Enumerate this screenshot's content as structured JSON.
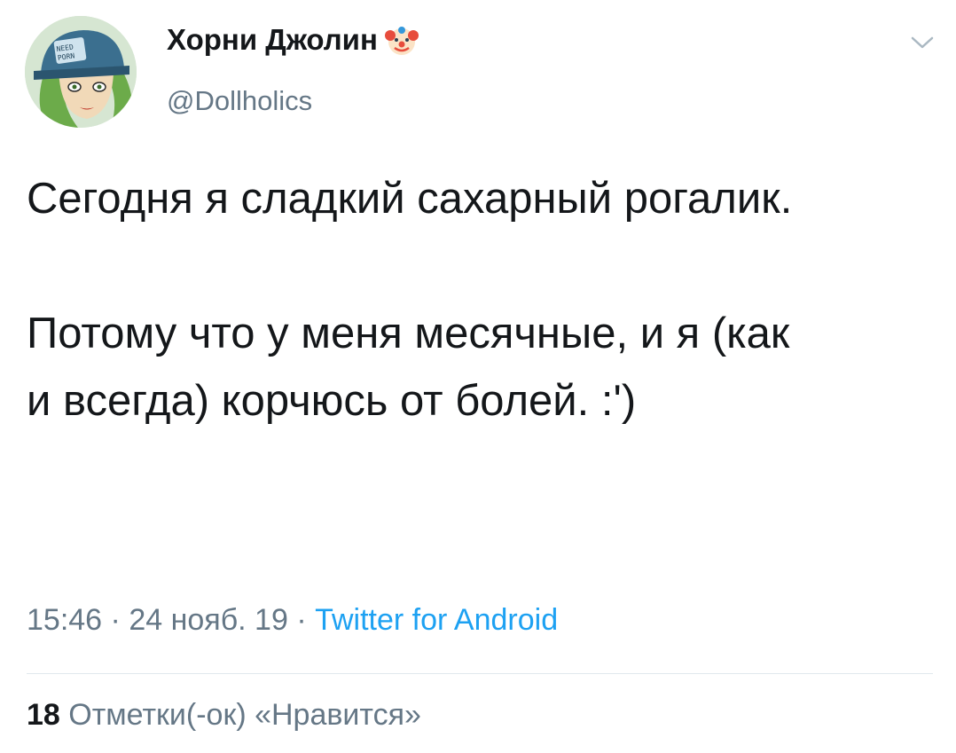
{
  "author": {
    "display_name": "Хорни Джолин",
    "handle": "@Dollholics",
    "name_emoji_icon": "clown-face-icon",
    "avatar_cap_text": "NEED PORN"
  },
  "tweet": {
    "paragraph1": "Сегодня я сладкий сахарный рогалик.",
    "paragraph2": "Потому что у меня месячные, и я (как и всегда) корчюсь от болей. :')"
  },
  "meta": {
    "time": "15:46",
    "date": "24 нояб. 19",
    "separator": "·",
    "source": "Twitter for Android"
  },
  "stats": {
    "likes_count": "18",
    "likes_label": "Отметки(-ок) «Нравится»"
  },
  "menu_icon": "chevron-down-icon",
  "colors": {
    "text": "#14171a",
    "secondary": "#657786",
    "link": "#1da1f2",
    "divider": "#e1e8ed"
  }
}
